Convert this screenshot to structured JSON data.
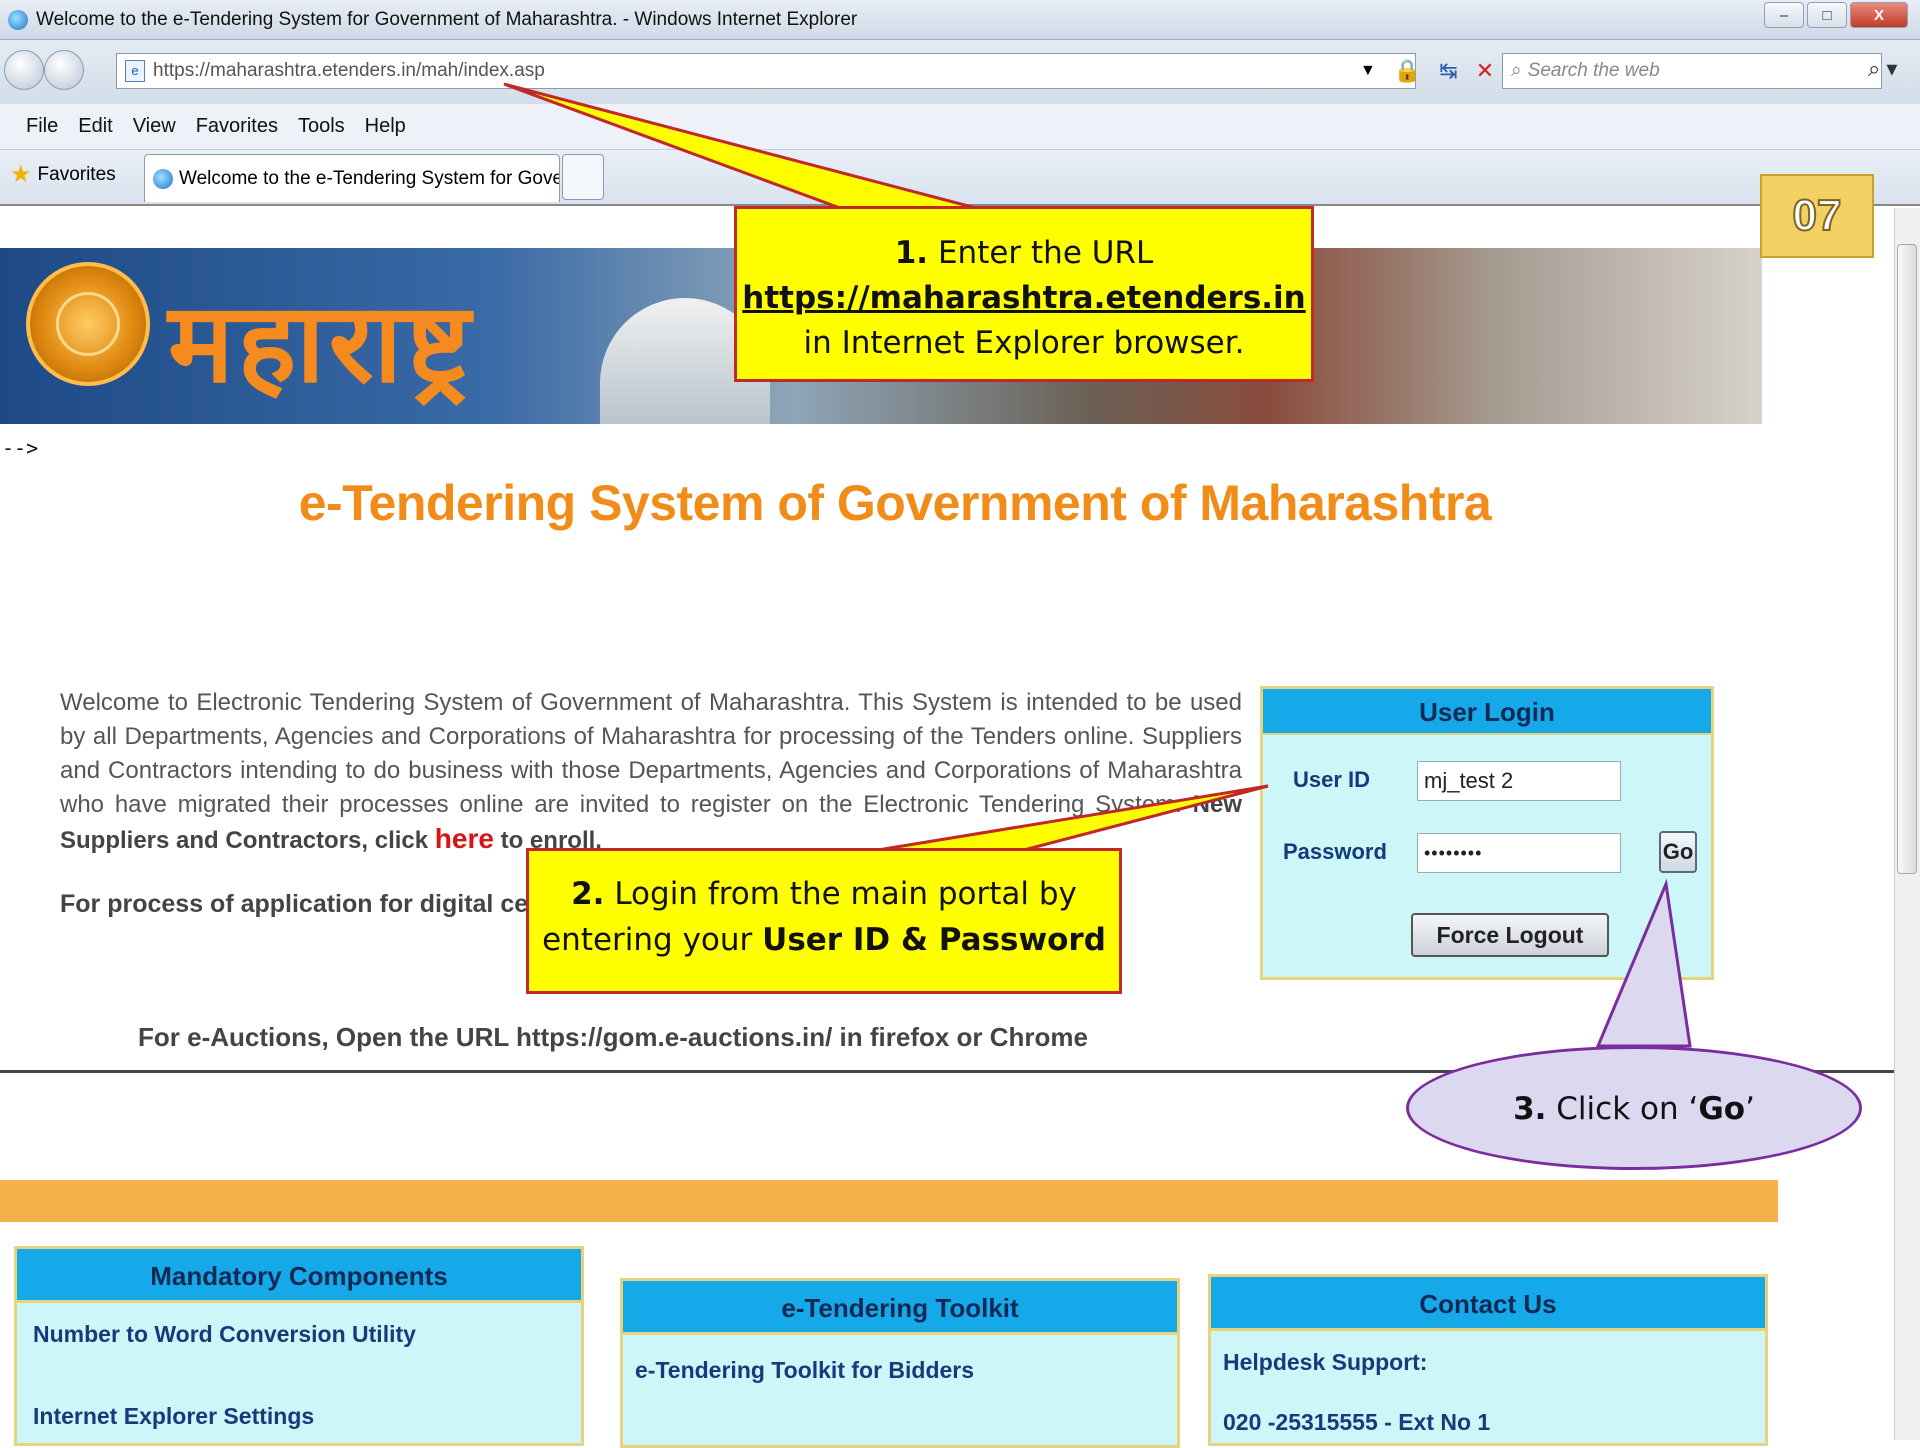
{
  "window": {
    "title": "Welcome to the e-Tendering System for Government of Maharashtra. - Windows Internet Explorer",
    "min": "–",
    "max": "□",
    "close": "X"
  },
  "address": {
    "url": "https://maharashtra.etenders.in/mah/index.asp",
    "search_placeholder": "Search the web",
    "page_icon": "e"
  },
  "menu": [
    "File",
    "Edit",
    "View",
    "Favorites",
    "Tools",
    "Help"
  ],
  "tabs": {
    "favorites": "Favorites",
    "active": "Welcome to the e-Tendering System for Govern..."
  },
  "page": {
    "comment_artifact": "-->",
    "title": "e-Tendering System of Government of Maharashtra",
    "welcome_text": "Welcome to Electronic Tendering System of Government of Maharashtra. This System is intended to be used by all Departments, Agencies and Corporations of Maharashtra for processing of the Tenders online. Suppliers and Contractors intending to do business with those Departments, Agencies and Corporations of Maharashtra who have migrated their processes online are invited to register on the Electronic Tendering System.",
    "enroll_prefix": "New Suppliers and Contractors, click",
    "enroll_link": "here",
    "enroll_suffix": "to enroll.",
    "digital_cert": "For process of application for digital certi",
    "auctions": "For e-Auctions, Open the URL https://gom.e-auctions.in/ in firefox or Chrome"
  },
  "login": {
    "heading": "User Login",
    "user_id_label": "User ID",
    "user_id_value": "mj_test 2",
    "password_label": "Password",
    "password_value": "••••••••",
    "go": "Go",
    "force_logout": "Force Logout"
  },
  "panels": {
    "mandatory": {
      "heading": "Mandatory Components",
      "items": [
        "Number to Word Conversion Utility",
        "Internet Explorer Settings"
      ]
    },
    "toolkit": {
      "heading": "e-Tendering Toolkit",
      "items": [
        "e-Tendering Toolkit for Bidders"
      ]
    },
    "contact": {
      "heading": "Contact Us",
      "items": [
        "Helpdesk Support:",
        "020 -25315555 - Ext No 1"
      ]
    }
  },
  "callouts": {
    "c1_num": "1.",
    "c1_pre": "Enter the URL",
    "c1_url": "https://maharashtra.etenders.in",
    "c1_post": "in Internet Explorer browser.",
    "c2_num": "2.",
    "c2_pre": "Login from the main portal by",
    "c2_mid": "entering your",
    "c2_bold": "User ID & Password",
    "c3_num": "3.",
    "c3_pre": "Click on ‘",
    "c3_bold": "Go",
    "c3_post": "’"
  },
  "badge": "07",
  "colors": {
    "accent_orange": "#f28c18",
    "panel_header": "#15a9e9",
    "callout_yellow": "#ffff00",
    "callout_border": "#c0282a",
    "bubble_purple": "#7a2e9e"
  }
}
